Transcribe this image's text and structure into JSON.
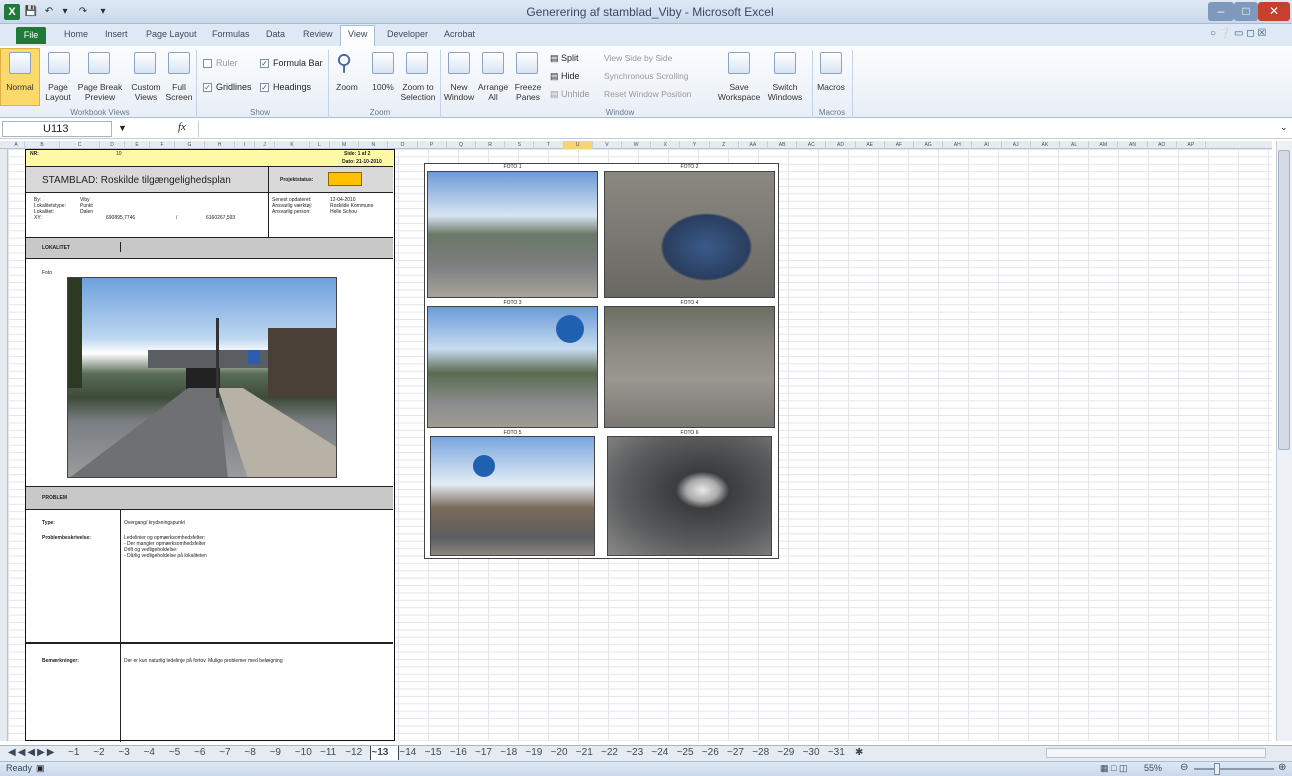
{
  "window": {
    "title": "Generering af stamblad_Viby - Microsoft Excel"
  },
  "ribbon_tabs": [
    "File",
    "Home",
    "Insert",
    "Page Layout",
    "Formulas",
    "Data",
    "Review",
    "View",
    "Developer",
    "Acrobat"
  ],
  "ribbon": {
    "workbook_views": {
      "group_label": "Workbook Views",
      "normal": "Normal",
      "page_layout": "Page Layout",
      "page_break_preview": "Page Break Preview",
      "custom_views": "Custom Views",
      "full_screen": "Full Screen"
    },
    "show": {
      "group_label": "Show",
      "ruler": "Ruler",
      "gridlines": "Gridlines",
      "formula_bar": "Formula Bar",
      "headings": "Headings"
    },
    "zoom": {
      "group_label": "Zoom",
      "zoom": "Zoom",
      "hundred": "100%",
      "zoom_to_selection": "Zoom to Selection"
    },
    "window": {
      "group_label": "Window",
      "new_window": "New Window",
      "arrange_all": "Arrange All",
      "freeze_panes": "Freeze Panes",
      "split": "Split",
      "hide": "Hide",
      "unhide": "Unhide",
      "view_side_by_side": "View Side by Side",
      "sync_scrolling": "Synchronous Scrolling",
      "reset_position": "Reset Window Position",
      "save_workspace": "Save Workspace",
      "switch_windows": "Switch Windows"
    },
    "macros": {
      "group_label": "Macros",
      "macros": "Macros"
    }
  },
  "formula_bar": {
    "name_box": "U113",
    "fx": "fx",
    "content": ""
  },
  "columns": [
    "A",
    "B",
    "C",
    "D",
    "E",
    "F",
    "G",
    "H",
    "I",
    "J",
    "K",
    "L",
    "M",
    "N",
    "O",
    "P",
    "Q",
    "R",
    "S",
    "T",
    "U",
    "V",
    "W",
    "X",
    "Y",
    "Z",
    "AA",
    "AB",
    "AC",
    "AD",
    "AE",
    "AF",
    "AG",
    "AH",
    "AI",
    "AJ",
    "AK",
    "AL",
    "AM",
    "AN",
    "AO",
    "AP"
  ],
  "stamblad": {
    "nr_label": "NR:",
    "nr_value": "10",
    "side": "Side: 1 af 2",
    "dato": "Dato: 21-10-2010",
    "title": "STAMBLAD: Roskilde tilgængelighedsplan",
    "status_label": "Projektstatus:",
    "by_label": "By:",
    "by_value": "Viby",
    "lok_type_label": "Lokalitetstype:",
    "lok_type_value": "Punkt",
    "lokalitet_label": "Lokalitet:",
    "lokalitet_value": "Dalen",
    "xy_label": "XY:",
    "x_value": "690895,7746",
    "y_value": "6160267,593",
    "opdateret_label": "Senest opdateret:",
    "opdateret_value": "12-04-2010",
    "vaerkt_label": "Ansvarlig værktøj:",
    "vaerkt_value": "Roskilde Kommune",
    "person_label": "Ansvarlig person:",
    "person_value": "Helle Schou",
    "lokalitet_header": "LOKALITET",
    "foto_label": "Foto",
    "problem_header": "PROBLEM",
    "type_label": "Type:",
    "type_value": "Overgang/ krydsningspunkt",
    "beskrivelse_label": "Problembeskrivelse:",
    "beskrivelse_lines": [
      "Ledelinier og opmærksomhedsfelter:",
      "- Der mangler opmærksomhedsfelter",
      "Drift og vedligeholdelse:",
      "- Dårlig vedligeholdelse på lokaliteten"
    ],
    "bemaerk_label": "Bemærkninger:",
    "bemaerk_value": "Der er kun naturlig ledelinje på fortov. Mulige problemer med belægning"
  },
  "photos": [
    "FOTO 1",
    "FOTO 2",
    "FOTO 3",
    "FOTO 4",
    "FOTO 5",
    "FOTO 6"
  ],
  "sheet_tabs": [
    "~1",
    "~2",
    "~3",
    "~4",
    "~5",
    "~6",
    "~7",
    "~8",
    "~9",
    "~10",
    "~11",
    "~12",
    "~13",
    "~14",
    "~15",
    "~16",
    "~17",
    "~18",
    "~19",
    "~20",
    "~21",
    "~22",
    "~23",
    "~24",
    "~25",
    "~26",
    "~27",
    "~28",
    "~29",
    "~30",
    "~31"
  ],
  "active_sheet": "~13",
  "status": {
    "ready": "Ready",
    "zoom": "55%"
  },
  "colors": {
    "excel_green": "#1f7a3a",
    "status_orange": "#ffc000",
    "title_yellow": "#fff8a6",
    "band_gray": "#c8c8c8"
  }
}
